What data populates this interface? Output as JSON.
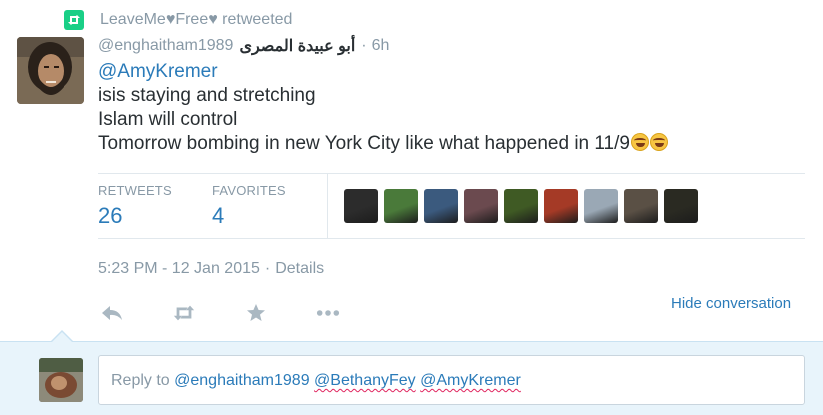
{
  "retweet": {
    "retweeter": "LeaveMe♥Free♥",
    "action": "retweeted"
  },
  "tweet": {
    "handle": "@enghaitham1989",
    "fullname": "أبو عبيدة المصرى",
    "age_separator": "·",
    "age": "6h",
    "mention": "@AmyKremer",
    "lines": [
      "isis staying and stretching",
      "Islam will control",
      "Tomorrow bombing in new York City like what happened in 11/9"
    ],
    "emojis": [
      "face-with-tears-of-joy",
      "face-with-tears-of-joy"
    ]
  },
  "stats": {
    "retweets_label": "RETWEETS",
    "retweets_value": "26",
    "favorites_label": "FAVORITES",
    "favorites_value": "4",
    "faces": [
      {
        "name": "user-avatar-1",
        "color": "#2c2c2c"
      },
      {
        "name": "user-avatar-2",
        "color": "#4a7a3a"
      },
      {
        "name": "user-avatar-3",
        "color": "#3b5a7e"
      },
      {
        "name": "user-avatar-4",
        "color": "#6b4a4f"
      },
      {
        "name": "user-avatar-5",
        "color": "#3f5a24"
      },
      {
        "name": "user-avatar-6",
        "color": "#a53a26"
      },
      {
        "name": "user-avatar-7",
        "color": "#9aa8b5"
      },
      {
        "name": "user-avatar-8",
        "color": "#5a5045"
      },
      {
        "name": "user-avatar-9",
        "color": "#2a2a22"
      }
    ]
  },
  "meta": {
    "time": "5:23 PM - 12 Jan 2015",
    "separator": "·",
    "details": "Details"
  },
  "actions": {
    "reply_icon": "reply-icon",
    "retweet_icon": "retweet-icon",
    "favorite_icon": "star-icon",
    "more_icon": "more-icon",
    "hide_conversation": "Hide conversation"
  },
  "reply": {
    "prefix": "Reply to ",
    "handles": [
      "@enghaitham1989",
      "@BethanyFey",
      "@AmyKremer"
    ]
  },
  "colors": {
    "link": "#2b7bb9",
    "muted": "#8899a6",
    "retweet_green": "#19cf86",
    "reply_bg": "#e8f4fb"
  }
}
